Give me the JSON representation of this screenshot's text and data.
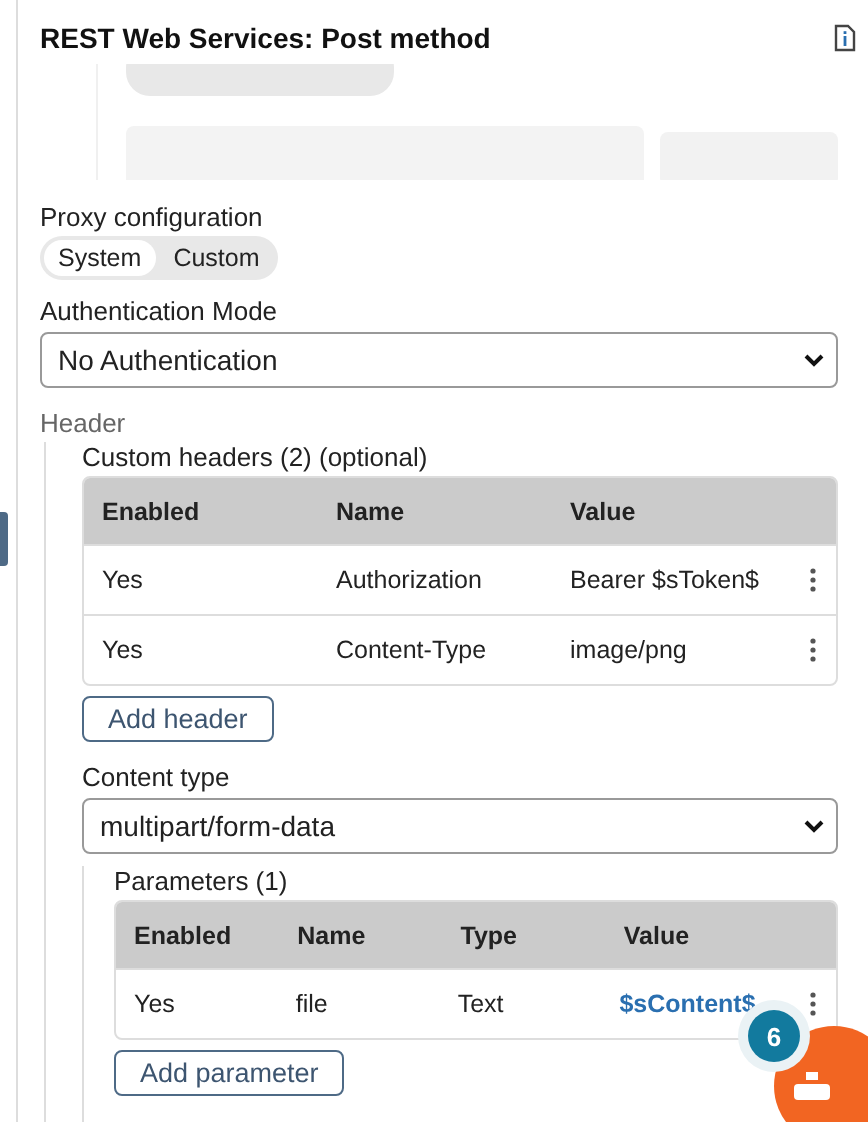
{
  "header": {
    "title": "REST Web Services: Post method"
  },
  "proxy": {
    "label": "Proxy configuration",
    "segments": [
      {
        "label": "System",
        "selected": true
      },
      {
        "label": "Custom",
        "selected": false
      }
    ]
  },
  "auth": {
    "label": "Authentication Mode",
    "value": "No Authentication"
  },
  "header_section": {
    "label": "Header",
    "custom_headers": {
      "label": "Custom headers (2) (optional)",
      "columns": [
        "Enabled",
        "Name",
        "Value"
      ],
      "rows": [
        {
          "cells": [
            "Yes",
            "Authorization",
            "Bearer $sToken$"
          ],
          "variable": false
        },
        {
          "cells": [
            "Yes",
            "Content-Type",
            "image/png"
          ],
          "variable": false
        }
      ],
      "button": "Add header"
    },
    "content_type": {
      "label": "Content type",
      "value": "multipart/form-data"
    },
    "parameters": {
      "label": "Parameters (1)",
      "columns": [
        "Enabled",
        "Name",
        "Type",
        "Value"
      ],
      "rows": [
        {
          "cells": [
            "Yes",
            "file",
            "Text",
            "$sContent$"
          ],
          "variable": true
        }
      ],
      "button": "Add parameter"
    }
  },
  "badge": {
    "count": "6"
  }
}
